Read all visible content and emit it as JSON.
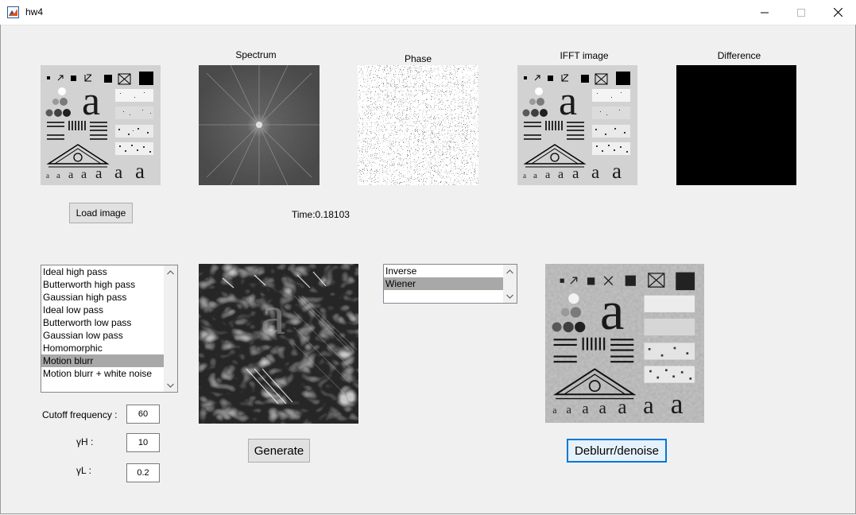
{
  "window": {
    "title": "hw4"
  },
  "axes_titles": {
    "spectrum": "Spectrum",
    "phase": "Phase",
    "ifft": "IFFT image",
    "difference": "Difference"
  },
  "buttons": {
    "load": "Load image",
    "generate": "Generate",
    "deblur": "Deblurr/denoise"
  },
  "time_text": "Time:0.18103",
  "filter_list": {
    "items": [
      "Ideal high pass",
      "Butterworth high pass",
      "Gaussian high pass",
      "Ideal low pass",
      "Butterworth low pass",
      "Gaussian low pass",
      "Homomorphic",
      "Motion blurr",
      "Motion blurr + white noise"
    ],
    "selected": "Motion blurr"
  },
  "restore_list": {
    "items": [
      "Inverse",
      "Wiener"
    ],
    "selected": "Wiener"
  },
  "params": {
    "cutoff_label": "Cutoff frequency :",
    "cutoff_value": "60",
    "gh_label": "γH :",
    "gh_value": "10",
    "gl_label": "γL :",
    "gl_value": "0.2"
  },
  "test_pattern_text": {
    "big_letter": "a",
    "small_letters": [
      "a",
      "a",
      "a",
      "a",
      "a",
      "a",
      "a"
    ]
  }
}
